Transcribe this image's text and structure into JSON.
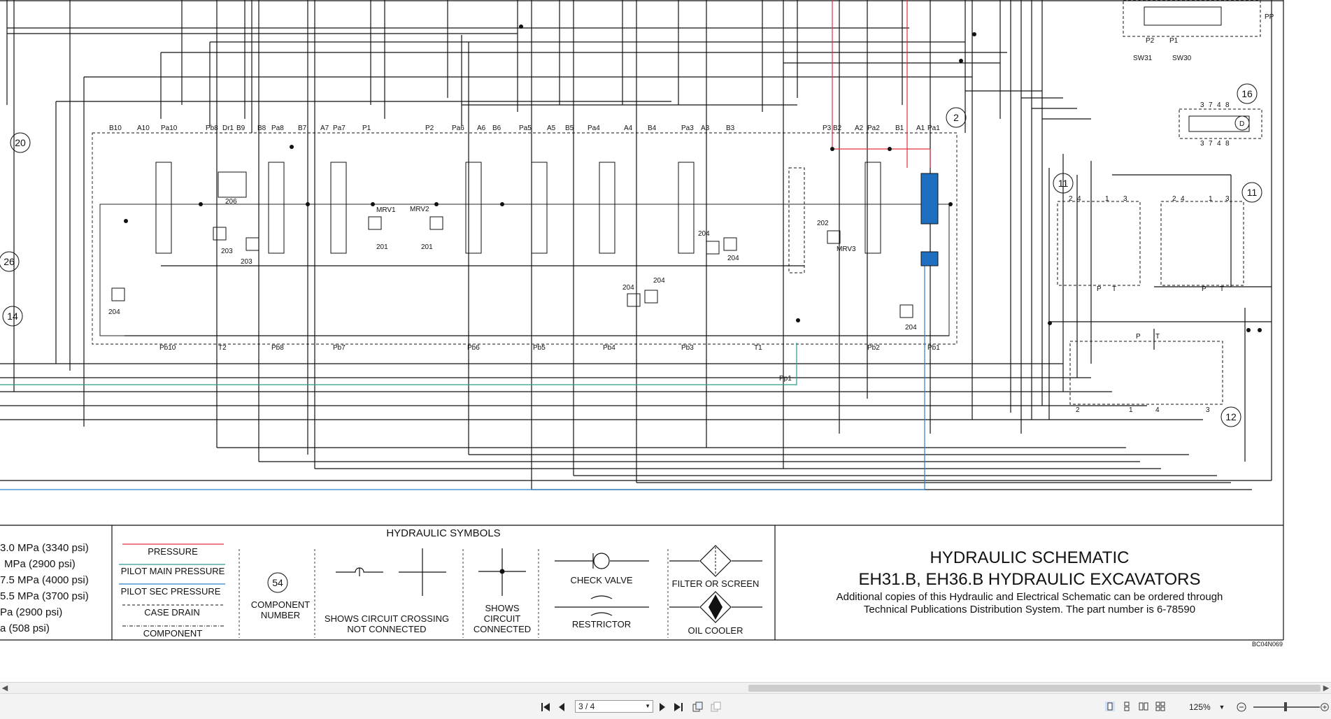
{
  "colors": {
    "pressure": "#e0303c",
    "pilot_main": "#2a9d8f",
    "pilot_sec": "#2a7fd0",
    "highlight": "#1f6fc0",
    "line": "#111111"
  },
  "callouts": [
    "20",
    "26",
    "14",
    "2",
    "16",
    "11",
    "11",
    "12"
  ],
  "section_labels": {
    "top": [
      "B10",
      "A10",
      "Pa10",
      "Pb8",
      "Dr1",
      "B9",
      "B8",
      "Pa8",
      "B7",
      "A7",
      "Pa7",
      "P1",
      "P2",
      "Pa6",
      "A6",
      "B6",
      "Pa5",
      "A5",
      "B5",
      "Pa4",
      "A4",
      "B4",
      "Pa3",
      "A3",
      "B3",
      "P3",
      "B2",
      "A2",
      "Pa2",
      "B1",
      "A1",
      "Pa1"
    ],
    "bottom": [
      "Pb10",
      "T2",
      "Pb8",
      "Pb7",
      "Pb6",
      "Pb5",
      "Pb4",
      "Pb3",
      "T1",
      "Pp1",
      "Pb2",
      "Pb1"
    ],
    "components": [
      "206",
      "203",
      "203",
      "204",
      "MRV1",
      "201",
      "MRV2",
      "201",
      "204",
      "204",
      "204",
      "204",
      "202",
      "MRV3",
      "204"
    ],
    "right": [
      "PP",
      "P2",
      "P1",
      "SW31",
      "SW30",
      "3",
      "7",
      "4",
      "8",
      "3",
      "7",
      "4",
      "8",
      "D",
      "2",
      "4",
      "1",
      "3",
      "P",
      "T",
      "2",
      "4",
      "1",
      "3",
      "P",
      "T",
      "P",
      "T",
      "2",
      "1",
      "4",
      "3"
    ]
  },
  "pressure_list": [
    "3.0 MPa (3340 psi)",
    "MPa (2900 psi)",
    "7.5 MPa (4000 psi)",
    "5.5 MPa (3700 psi)",
    "Pa (2900 psi)",
    "a (508 psi)"
  ],
  "legend": {
    "heading": "HYDRAULIC SYMBOLS",
    "lines": [
      "PRESSURE",
      "PILOT MAIN PRESSURE",
      "PILOT SEC PRESSURE",
      "CASE DRAIN",
      "COMPONENT"
    ],
    "component_number_sample": "54",
    "component_number_label": [
      "COMPONENT",
      "NUMBER"
    ],
    "crossing_label": [
      "SHOWS CIRCUIT CROSSING",
      "NOT CONNECTED"
    ],
    "connected_label": [
      "SHOWS",
      "CIRCUIT",
      "CONNECTED"
    ],
    "check_valve": "CHECK VALVE",
    "restrictor": "RESTRICTOR",
    "filter": "FILTER OR SCREEN",
    "oil_cooler": "OIL COOLER"
  },
  "title_block": {
    "title_1": "HYDRAULIC SCHEMATIC",
    "title_2": "EH31.B, EH36.B HYDRAULIC EXCAVATORS",
    "note_1": "Additional copies of this Hydraulic and Electrical Schematic can be ordered through",
    "note_2": "Technical Publications Distribution System. The part number is 6-78590",
    "drawing_code": "BC04N069"
  },
  "toolbar": {
    "first_icon": "first-page-icon",
    "prev_icon": "prev-page-icon",
    "page_value": "3 / 4",
    "next_icon": "next-page-icon",
    "last_icon": "last-page-icon",
    "zoom_value": "125%"
  }
}
